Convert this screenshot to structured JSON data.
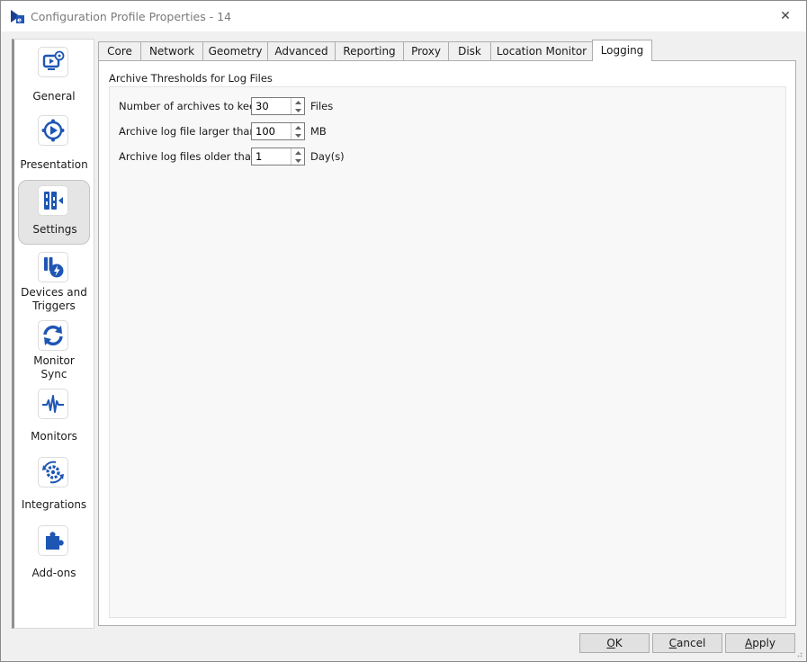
{
  "window": {
    "title": "Configuration Profile Properties - 14",
    "close_symbol": "✕"
  },
  "nav": {
    "items": [
      {
        "label_lines": [
          "General"
        ],
        "icon": "monitor-gear-icon"
      },
      {
        "label_lines": [
          "Presentation"
        ],
        "icon": "play-presentation-icon"
      },
      {
        "label_lines": [
          "Settings"
        ],
        "icon": "settings-sliders-icon",
        "selected": true
      },
      {
        "label_lines": [
          "Devices and",
          "Triggers"
        ],
        "icon": "devices-lightning-icon"
      },
      {
        "label_lines": [
          "Monitor",
          "Sync"
        ],
        "icon": "sync-arrows-icon"
      },
      {
        "label_lines": [
          "Monitors"
        ],
        "icon": "pulse-icon"
      },
      {
        "label_lines": [
          "Integrations"
        ],
        "icon": "integration-gear-icon"
      },
      {
        "label_lines": [
          "Add-ons"
        ],
        "icon": "puzzle-piece-icon"
      }
    ]
  },
  "tabs": [
    "Core",
    "Network",
    "Geometry",
    "Advanced",
    "Reporting",
    "Proxy",
    "Disk",
    "Location Monitor",
    "Logging"
  ],
  "active_tab": "Logging",
  "logging": {
    "group_title": "Archive Thresholds for Log Files",
    "rows": [
      {
        "label": "Number of archives to keep",
        "value": "30",
        "unit": "Files"
      },
      {
        "label": "Archive log file larger than",
        "value": "100",
        "unit": "MB"
      },
      {
        "label": "Archive log files older than",
        "value": "1",
        "unit": "Day(s)"
      }
    ]
  },
  "buttons": {
    "ok": {
      "pre": "",
      "accel": "O",
      "post": "K"
    },
    "cancel": {
      "pre": "",
      "accel": "C",
      "post": "ancel"
    },
    "apply": {
      "pre": "",
      "accel": "A",
      "post": "pply"
    }
  },
  "colors": {
    "accent": "#1e56b4",
    "nav_selected": "#e5e5e5"
  }
}
